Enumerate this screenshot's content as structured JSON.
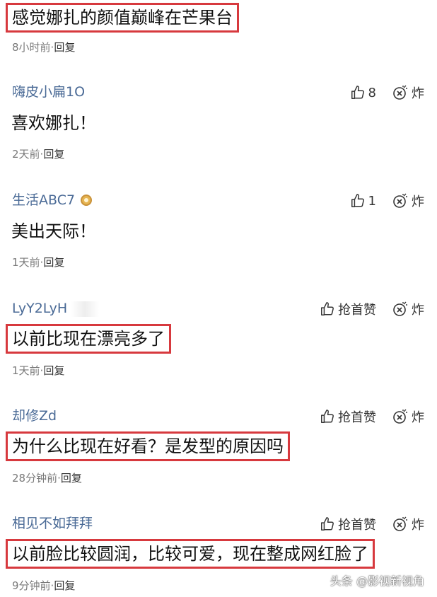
{
  "top_comment": {
    "text": "感觉娜扎的颜值巅峰在芒果台",
    "time": "8小时前",
    "reply": "回复"
  },
  "comments": [
    {
      "user": "嗨皮小扁1O",
      "likes": "8",
      "boom": "炸",
      "text": "喜欢娜扎！",
      "time": "2天前",
      "reply": "回复",
      "highlighted": false
    },
    {
      "user": "生活ABC7",
      "likes": "1",
      "boom": "炸",
      "text": "美出天际！",
      "time": "1天前",
      "reply": "回复",
      "highlighted": false,
      "badge": "medal-icon"
    },
    {
      "user": "LyY2LyH",
      "likes": "抢首赞",
      "boom": "炸",
      "text": "以前比现在漂亮多了",
      "time": "1天前",
      "reply": "回复",
      "highlighted": true
    },
    {
      "user": "却修Zd",
      "likes": "抢首赞",
      "boom": "炸",
      "text": "为什么比现在好看？是发型的原因吗",
      "time": "28分钟前",
      "reply": "回复",
      "highlighted": true
    },
    {
      "user": "相见不如拜拜",
      "likes": "抢首赞",
      "boom": "炸",
      "text": "以前脸比较圆润，比较可爱，现在整成网红脸了",
      "time": "9分钟前",
      "reply": "回复",
      "highlighted": true
    }
  ],
  "watermark": "头条 @影视新视角",
  "colors": {
    "username": "#4a6a96",
    "highlight_border": "#d7393e",
    "meta": "#7a7a7a"
  }
}
